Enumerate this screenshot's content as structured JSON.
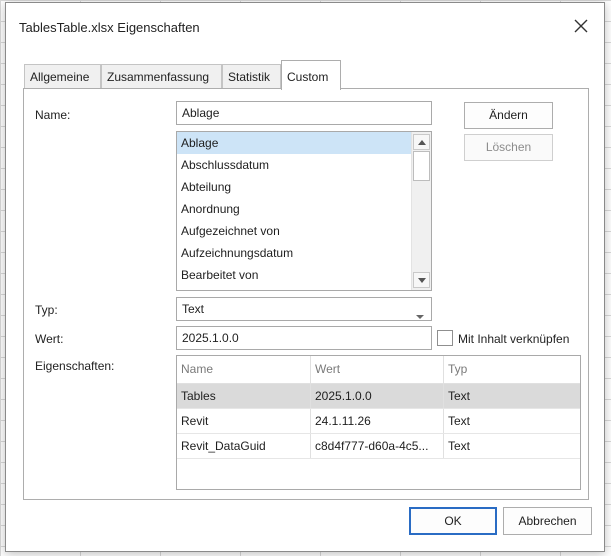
{
  "window": {
    "title": "TablesTable.xlsx Eigenschaften"
  },
  "tabs": [
    {
      "label": "Allgemeine"
    },
    {
      "label": "Zusammenfassung"
    },
    {
      "label": "Statistik"
    },
    {
      "label": "Custom"
    }
  ],
  "active_tab": "Custom",
  "form": {
    "name_label": "Name:",
    "name_value": "Ablage",
    "name_list": [
      "Ablage",
      "Abschlussdatum",
      "Abteilung",
      "Anordnung",
      "Aufgezeichnet von",
      "Aufzeichnungsdatum",
      "Bearbeitet von"
    ],
    "selected_name": "Ablage",
    "type_label": "Typ:",
    "type_value": "Text",
    "value_label": "Wert:",
    "value_value": "2025.1.0.0",
    "link_label": "Mit Inhalt verknüpfen",
    "link_checked": false,
    "properties_label": "Eigenschaften:"
  },
  "buttons": {
    "change": "Ändern",
    "delete": "Löschen",
    "ok": "OK",
    "cancel": "Abbrechen"
  },
  "properties_table": {
    "columns": [
      "Name",
      "Wert",
      "Typ"
    ],
    "rows": [
      {
        "name": "Tables",
        "value": "2025.1.0.0",
        "type": "Text"
      },
      {
        "name": "Revit",
        "value": "24.1.11.26",
        "type": "Text"
      },
      {
        "name": "Revit_DataGuid",
        "value": "c8d4f777-d60a-4c5...",
        "type": "Text"
      }
    ],
    "selected_row": 0
  },
  "colors": {
    "selection": "#cde4f7",
    "selected_row": "#dadada",
    "default_button_border": "#2a6cc4"
  }
}
